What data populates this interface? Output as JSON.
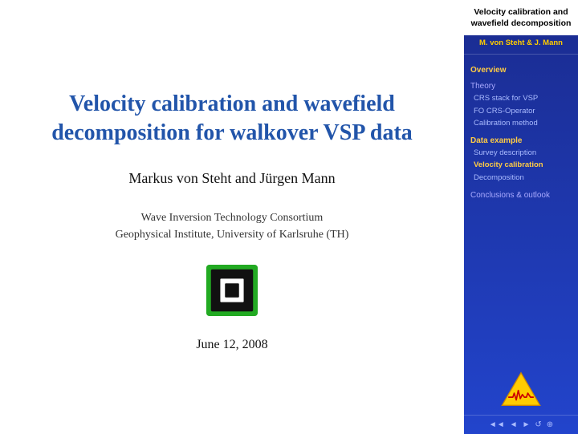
{
  "slide": {
    "title": "Velocity calibration and wavefield decomposition for walkover VSP data",
    "authors": "Markus von Steht and Jürgen Mann",
    "institution_line1": "Wave Inversion Technology Consortium",
    "institution_line2": "Geophysical Institute, University of Karlsruhe (TH)",
    "date": "June 12, 2008"
  },
  "sidebar": {
    "header": "Velocity calibration and wavefield decomposition",
    "author": "M. von Steht & J. Mann",
    "nav": [
      {
        "label": "Overview",
        "type": "section",
        "active": true
      },
      {
        "label": "Theory",
        "type": "section"
      },
      {
        "label": "CRS stack for VSP",
        "type": "item"
      },
      {
        "label": "FO CRS-Operator",
        "type": "item"
      },
      {
        "label": "Calibration method",
        "type": "item"
      },
      {
        "label": "Data example",
        "type": "section",
        "highlighted": true
      },
      {
        "label": "Survey description",
        "type": "item"
      },
      {
        "label": "Velocity calibration",
        "type": "item",
        "active": true
      },
      {
        "label": "Decomposition",
        "type": "item"
      },
      {
        "label": "Conclusions & outlook",
        "type": "section"
      }
    ],
    "footer_icons": [
      "◄",
      "◄",
      "►",
      "►",
      "↺",
      "⊕"
    ]
  }
}
